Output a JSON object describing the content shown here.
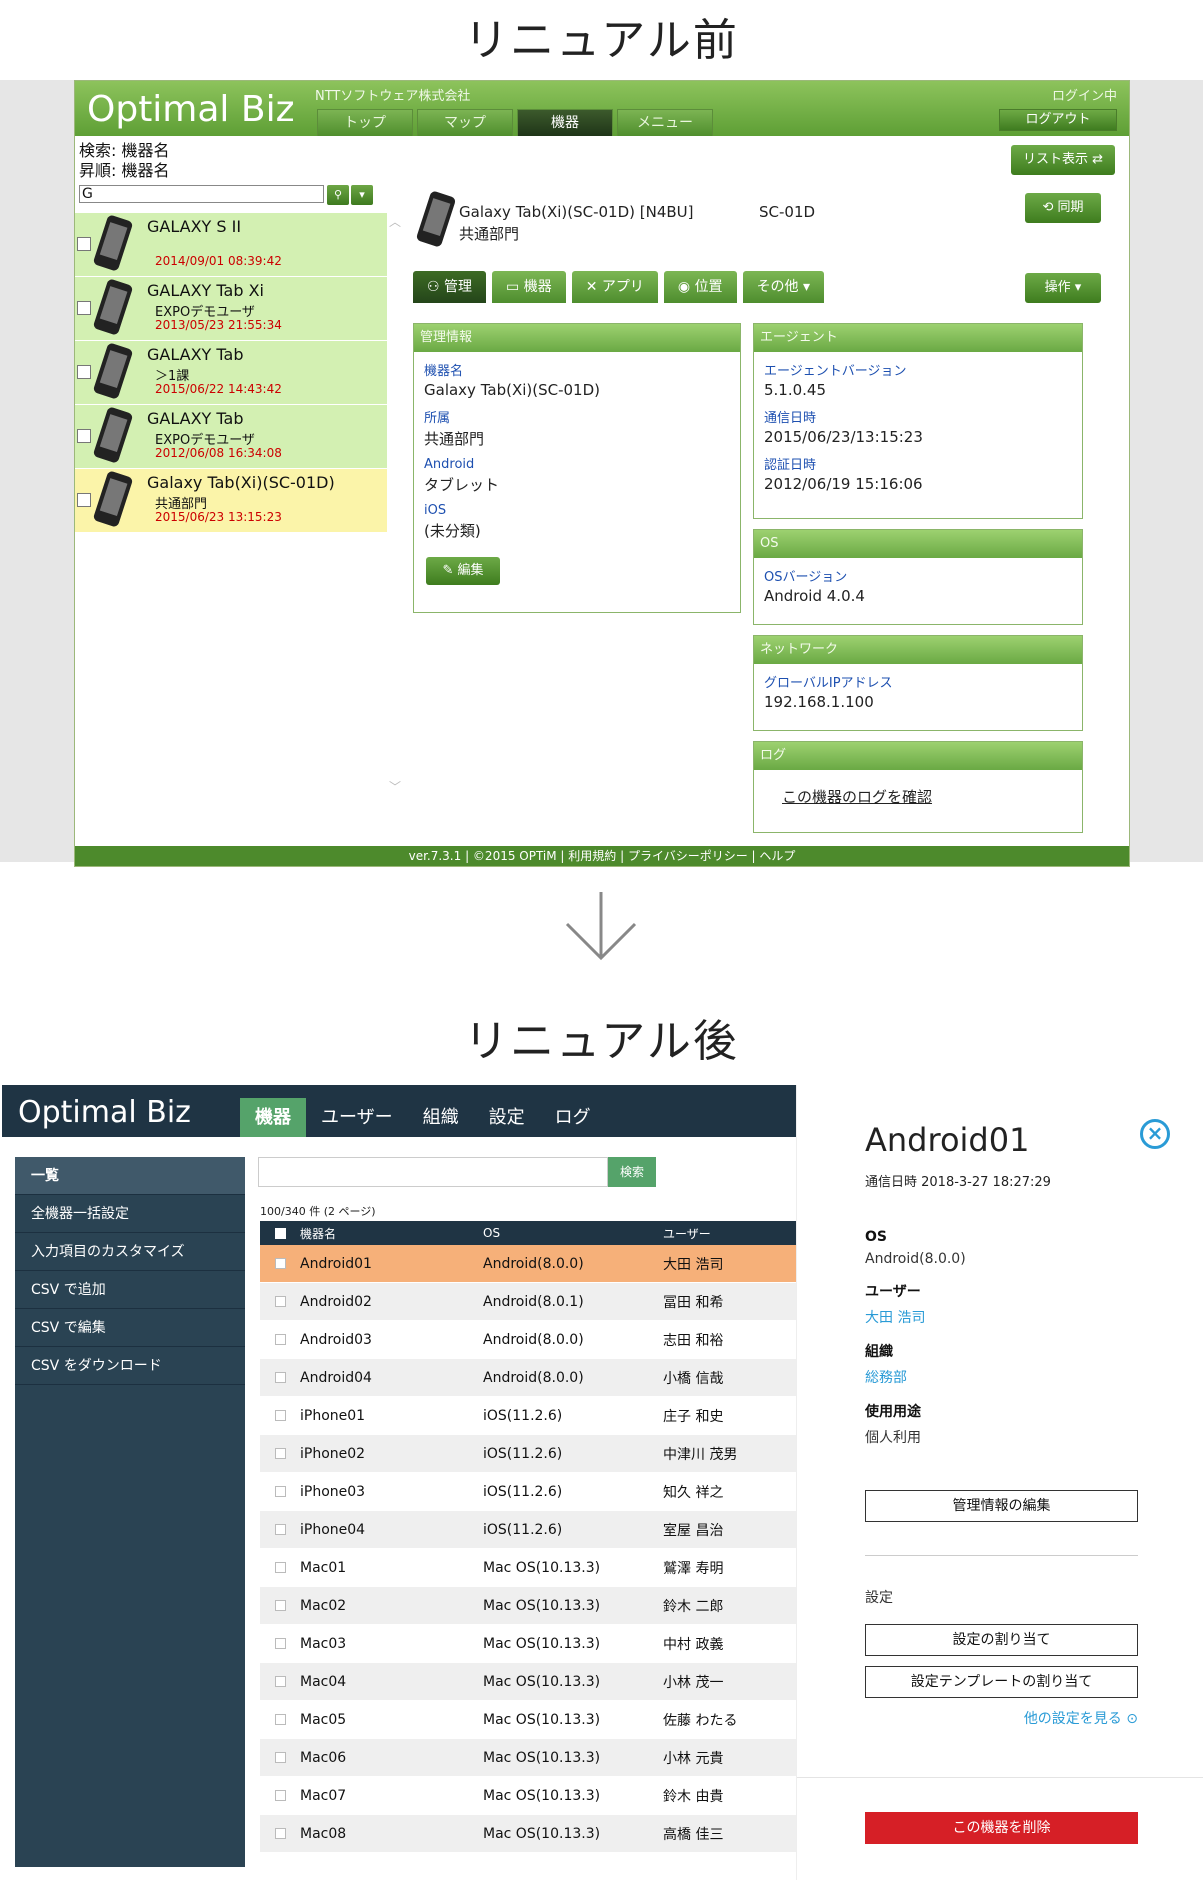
{
  "titles": {
    "before": "リニュアル前",
    "after": "リニュアル後"
  },
  "old_ui": {
    "logo": "Optimal Biz",
    "company": "NTTソフトウェア株式会社",
    "login_status": "ログイン中",
    "logout_label": "ログアウト",
    "nav_tabs": [
      "トップ",
      "マップ",
      "機器",
      "メニュー"
    ],
    "search_label": "検索: 機器名",
    "sort_label": "昇順: 機器名",
    "search_value": "G",
    "list_view_label": "リスト表示",
    "sync_label": "同期",
    "devices": [
      {
        "name": "GALAXY S II",
        "sub": "",
        "date": "2014/09/01 08:39:42"
      },
      {
        "name": "GALAXY Tab Xi",
        "sub": "EXPOデモユーザ",
        "date": "2013/05/23 21:55:34"
      },
      {
        "name": "GALAXY Tab",
        "sub": "＞1課",
        "date": "2015/06/22 14:43:42"
      },
      {
        "name": "GALAXY Tab",
        "sub": "EXPOデモユーザ",
        "date": "2012/06/08 16:34:08"
      },
      {
        "name": "Galaxy Tab(Xi)(SC-01D)",
        "sub": "共通部門",
        "date": "2015/06/23 13:15:23"
      }
    ],
    "detail": {
      "name": "Galaxy Tab(Xi)(SC-01D) [N4BU]",
      "group": "共通部門",
      "model": "SC-01D",
      "tabs": [
        "管理",
        "機器",
        "アプリ",
        "位置",
        "その他 ▾"
      ],
      "operation_label": "操作 ▾",
      "mgmt_panel": {
        "title": "管理情報",
        "fields": [
          {
            "label": "機器名",
            "value": "Galaxy Tab(Xi)(SC-01D)"
          },
          {
            "label": "所属",
            "value": "共通部門"
          },
          {
            "label": "Android",
            "value": "タブレット"
          },
          {
            "label": "iOS",
            "value": "(未分類)"
          }
        ],
        "edit_label": "編集"
      },
      "agent_panel": {
        "title": "エージェント",
        "fields": [
          {
            "label": "エージェントバージョン",
            "value": "5.1.0.45"
          },
          {
            "label": "通信日時",
            "value": "2015/06/23/13:15:23"
          },
          {
            "label": "認証日時",
            "value": "2012/06/19 15:16:06"
          }
        ]
      },
      "os_panel": {
        "title": "OS",
        "label": "OSバージョン",
        "value": "Android 4.0.4"
      },
      "network_panel": {
        "title": "ネットワーク",
        "label": "グローバルIPアドレス",
        "value": "192.168.1.100"
      },
      "log_panel": {
        "title": "ログ",
        "link": "この機器のログを確認"
      }
    },
    "footer": "ver.7.3.1 | ©2015 OPTiM | 利用規約 | プライバシーポリシー | ヘルプ"
  },
  "new_ui": {
    "logo": "Optimal Biz",
    "tabs": [
      "機器",
      "ユーザー",
      "組織",
      "設定",
      "ログ"
    ],
    "sidebar": [
      "一覧",
      "全機器一括設定",
      "入力項目のカスタマイズ",
      "CSV で追加",
      "CSV で編集",
      "CSV をダウンロード"
    ],
    "search_button": "検索",
    "count": "100/340 件 (2 ページ)",
    "columns": [
      "機器名",
      "OS",
      "ユーザー"
    ],
    "rows": [
      [
        "Android01",
        "Android(8.0.0)",
        "大田 浩司"
      ],
      [
        "Android02",
        "Android(8.0.1)",
        "冨田 和希"
      ],
      [
        "Android03",
        "Android(8.0.0)",
        "志田 和裕"
      ],
      [
        "Android04",
        "Android(8.0.0)",
        "小橋 信哉"
      ],
      [
        "iPhone01",
        "iOS(11.2.6)",
        "庄子 和史"
      ],
      [
        "iPhone02",
        "iOS(11.2.6)",
        "中津川 茂男"
      ],
      [
        "iPhone03",
        "iOS(11.2.6)",
        "知久 祥之"
      ],
      [
        "iPhone04",
        "iOS(11.2.6)",
        "室屋 昌治"
      ],
      [
        "Mac01",
        "Mac OS(10.13.3)",
        "鷲澤 寿明"
      ],
      [
        "Mac02",
        "Mac OS(10.13.3)",
        "鈴木 二郎"
      ],
      [
        "Mac03",
        "Mac OS(10.13.3)",
        "中村 政義"
      ],
      [
        "Mac04",
        "Mac OS(10.13.3)",
        "小林 茂一"
      ],
      [
        "Mac05",
        "Mac OS(10.13.3)",
        "佐藤 わたる"
      ],
      [
        "Mac06",
        "Mac OS(10.13.3)",
        "小林 元貴"
      ],
      [
        "Mac07",
        "Mac OS(10.13.3)",
        "鈴木 由貴"
      ],
      [
        "Mac08",
        "Mac OS(10.13.3)",
        "高橋 佳三"
      ]
    ],
    "detail": {
      "title": "Android01",
      "timestamp": "通信日時 2018-3-27 18:27:29",
      "fields": [
        {
          "label": "OS",
          "value": "Android(8.0.0)",
          "link": false
        },
        {
          "label": "ユーザー",
          "value": "大田 浩司",
          "link": true
        },
        {
          "label": "組織",
          "value": "総務部",
          "link": true
        },
        {
          "label": "使用用途",
          "value": "個人利用",
          "link": false
        }
      ],
      "edit_button": "管理情報の編集",
      "settings_label": "設定",
      "assign_button": "設定の割り当て",
      "template_button": "設定テンプレートの割り当て",
      "more_link": "他の設定を見る",
      "delete_button": "この機器を削除"
    }
  },
  "colors": {
    "old_green": "#5e9f35",
    "new_navy": "#1f3444",
    "new_accent": "#55a36a",
    "selected_row": "#f6b079",
    "link_blue": "#2a9bd6",
    "delete_red": "#d61f26"
  }
}
